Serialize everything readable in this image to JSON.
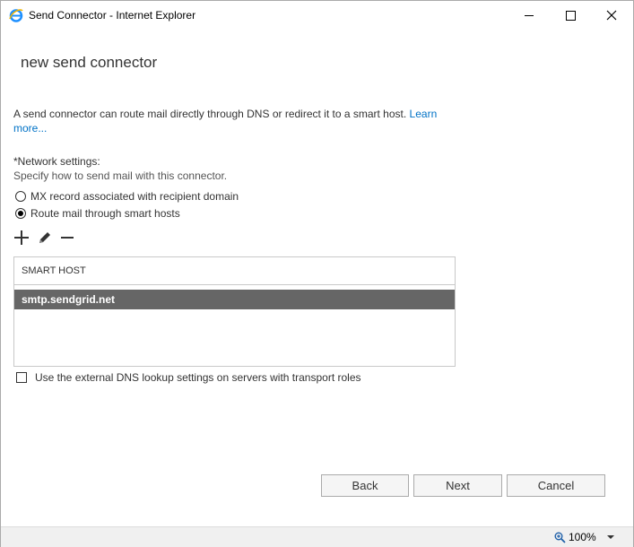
{
  "window": {
    "title": "Send Connector - Internet Explorer"
  },
  "page": {
    "heading": "new send connector",
    "description": "A send connector can route mail directly through DNS or redirect it to a smart host.",
    "learn_more": "Learn more...",
    "network_label": "*Network settings:",
    "network_sub": "Specify how to send mail with this connector.",
    "radio_mx": "MX record associated with recipient domain",
    "radio_smarthost": "Route mail through smart hosts",
    "table_header": "SMART HOST",
    "smart_hosts": [
      "smtp.sendgrid.net"
    ],
    "dns_checkbox": "Use the external DNS lookup settings on servers with transport roles"
  },
  "buttons": {
    "back": "Back",
    "next": "Next",
    "cancel": "Cancel"
  },
  "status": {
    "zoom": "100%"
  },
  "colors": {
    "link": "#0072c6",
    "selected_row": "#666666"
  }
}
